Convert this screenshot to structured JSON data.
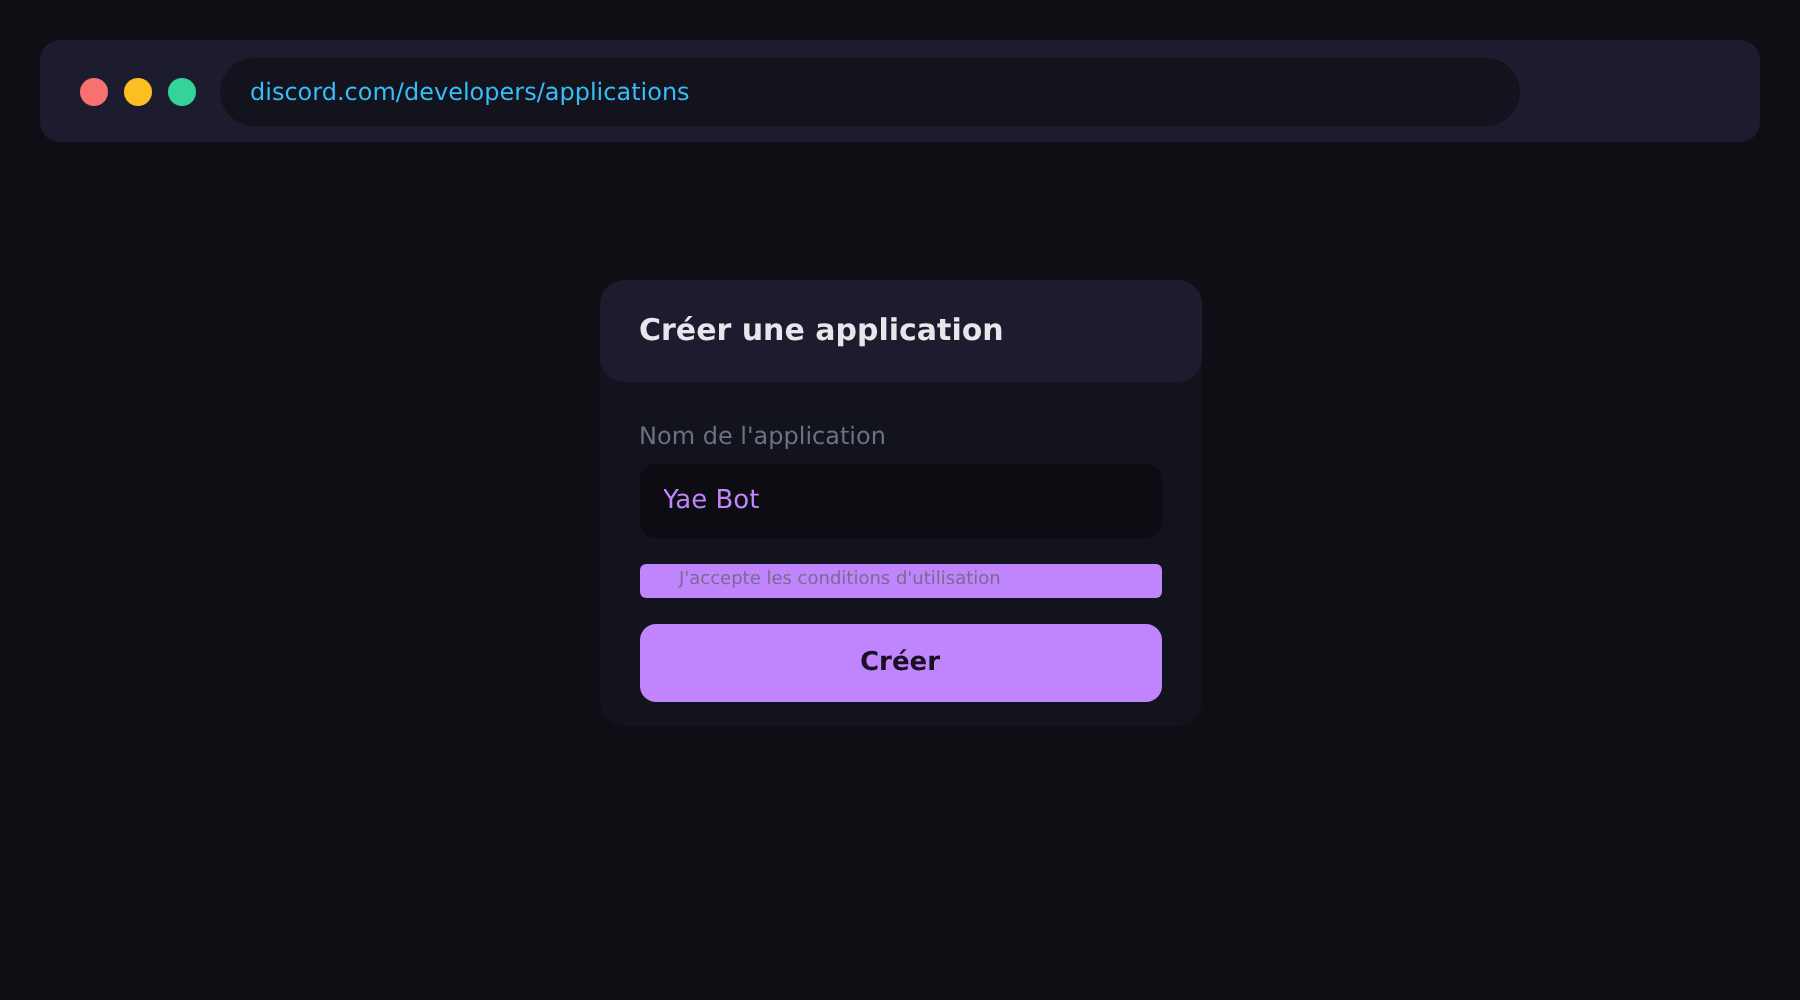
{
  "browser": {
    "url": "discord.com/developers/applications"
  },
  "dialog": {
    "title": "Créer une application",
    "name_field": {
      "label": "Nom de l'application",
      "value": "Yae Bot"
    },
    "terms": {
      "label": "J'accepte les conditions d'utilisation"
    },
    "submit": "Créer"
  }
}
